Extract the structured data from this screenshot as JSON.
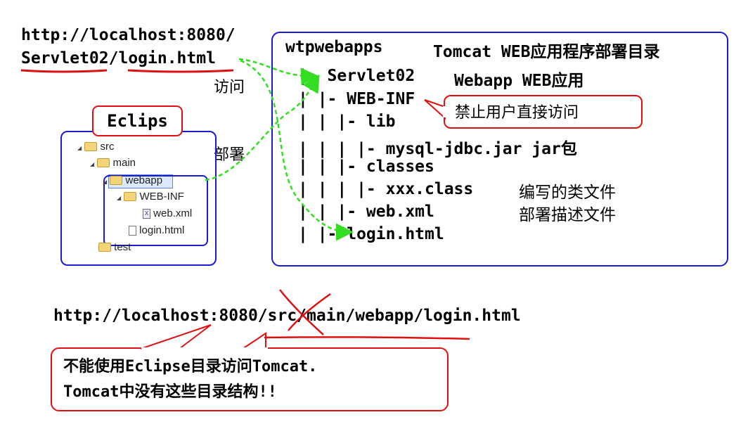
{
  "top_url": {
    "line1": "http://localhost:8080/",
    "line2": "Servlet02/login.html"
  },
  "labels": {
    "access": "访问",
    "deploy": "部署"
  },
  "eclipse": {
    "title": "Eclips",
    "tree": {
      "src": "src",
      "main": "main",
      "webapp": "webapp",
      "webinf": "WEB-INF",
      "webxml": "web.xml",
      "login": "login.html",
      "test": "test"
    }
  },
  "tomcat": {
    "header_name": "wtpwebapps",
    "header_desc": "Tomcat WEB应用程序部署目录",
    "lines": [
      {
        "tree": "|- Servlet02",
        "desc": "Webapp WEB应用"
      },
      {
        "tree": "|  |- WEB-INF",
        "desc": ""
      },
      {
        "tree": "|  |  |- lib",
        "desc": ""
      },
      {
        "tree": "|  |  |  |- mysql-jdbc.jar jar包",
        "desc": ""
      },
      {
        "tree": "|  |  |- classes",
        "desc": ""
      },
      {
        "tree": "|  |  |  |- xxx.class",
        "desc": "编写的类文件"
      },
      {
        "tree": "|  |  |- web.xml",
        "desc": "部署描述文件"
      },
      {
        "tree": "|  |- login.html",
        "desc": ""
      }
    ],
    "webinf_callout": "禁止用户直接访问"
  },
  "bottom": {
    "url": "http://localhost:8080/src/main/webapp/login.html",
    "callout_line1": "不能使用Eclipse目录访问Tomcat.",
    "callout_line2": "Tomcat中没有这些目录结构!!"
  },
  "colors": {
    "box_border": "#1a1ad6",
    "callout_border": "#e01010",
    "arrow": "#33dd22",
    "underline": "#e01010"
  }
}
